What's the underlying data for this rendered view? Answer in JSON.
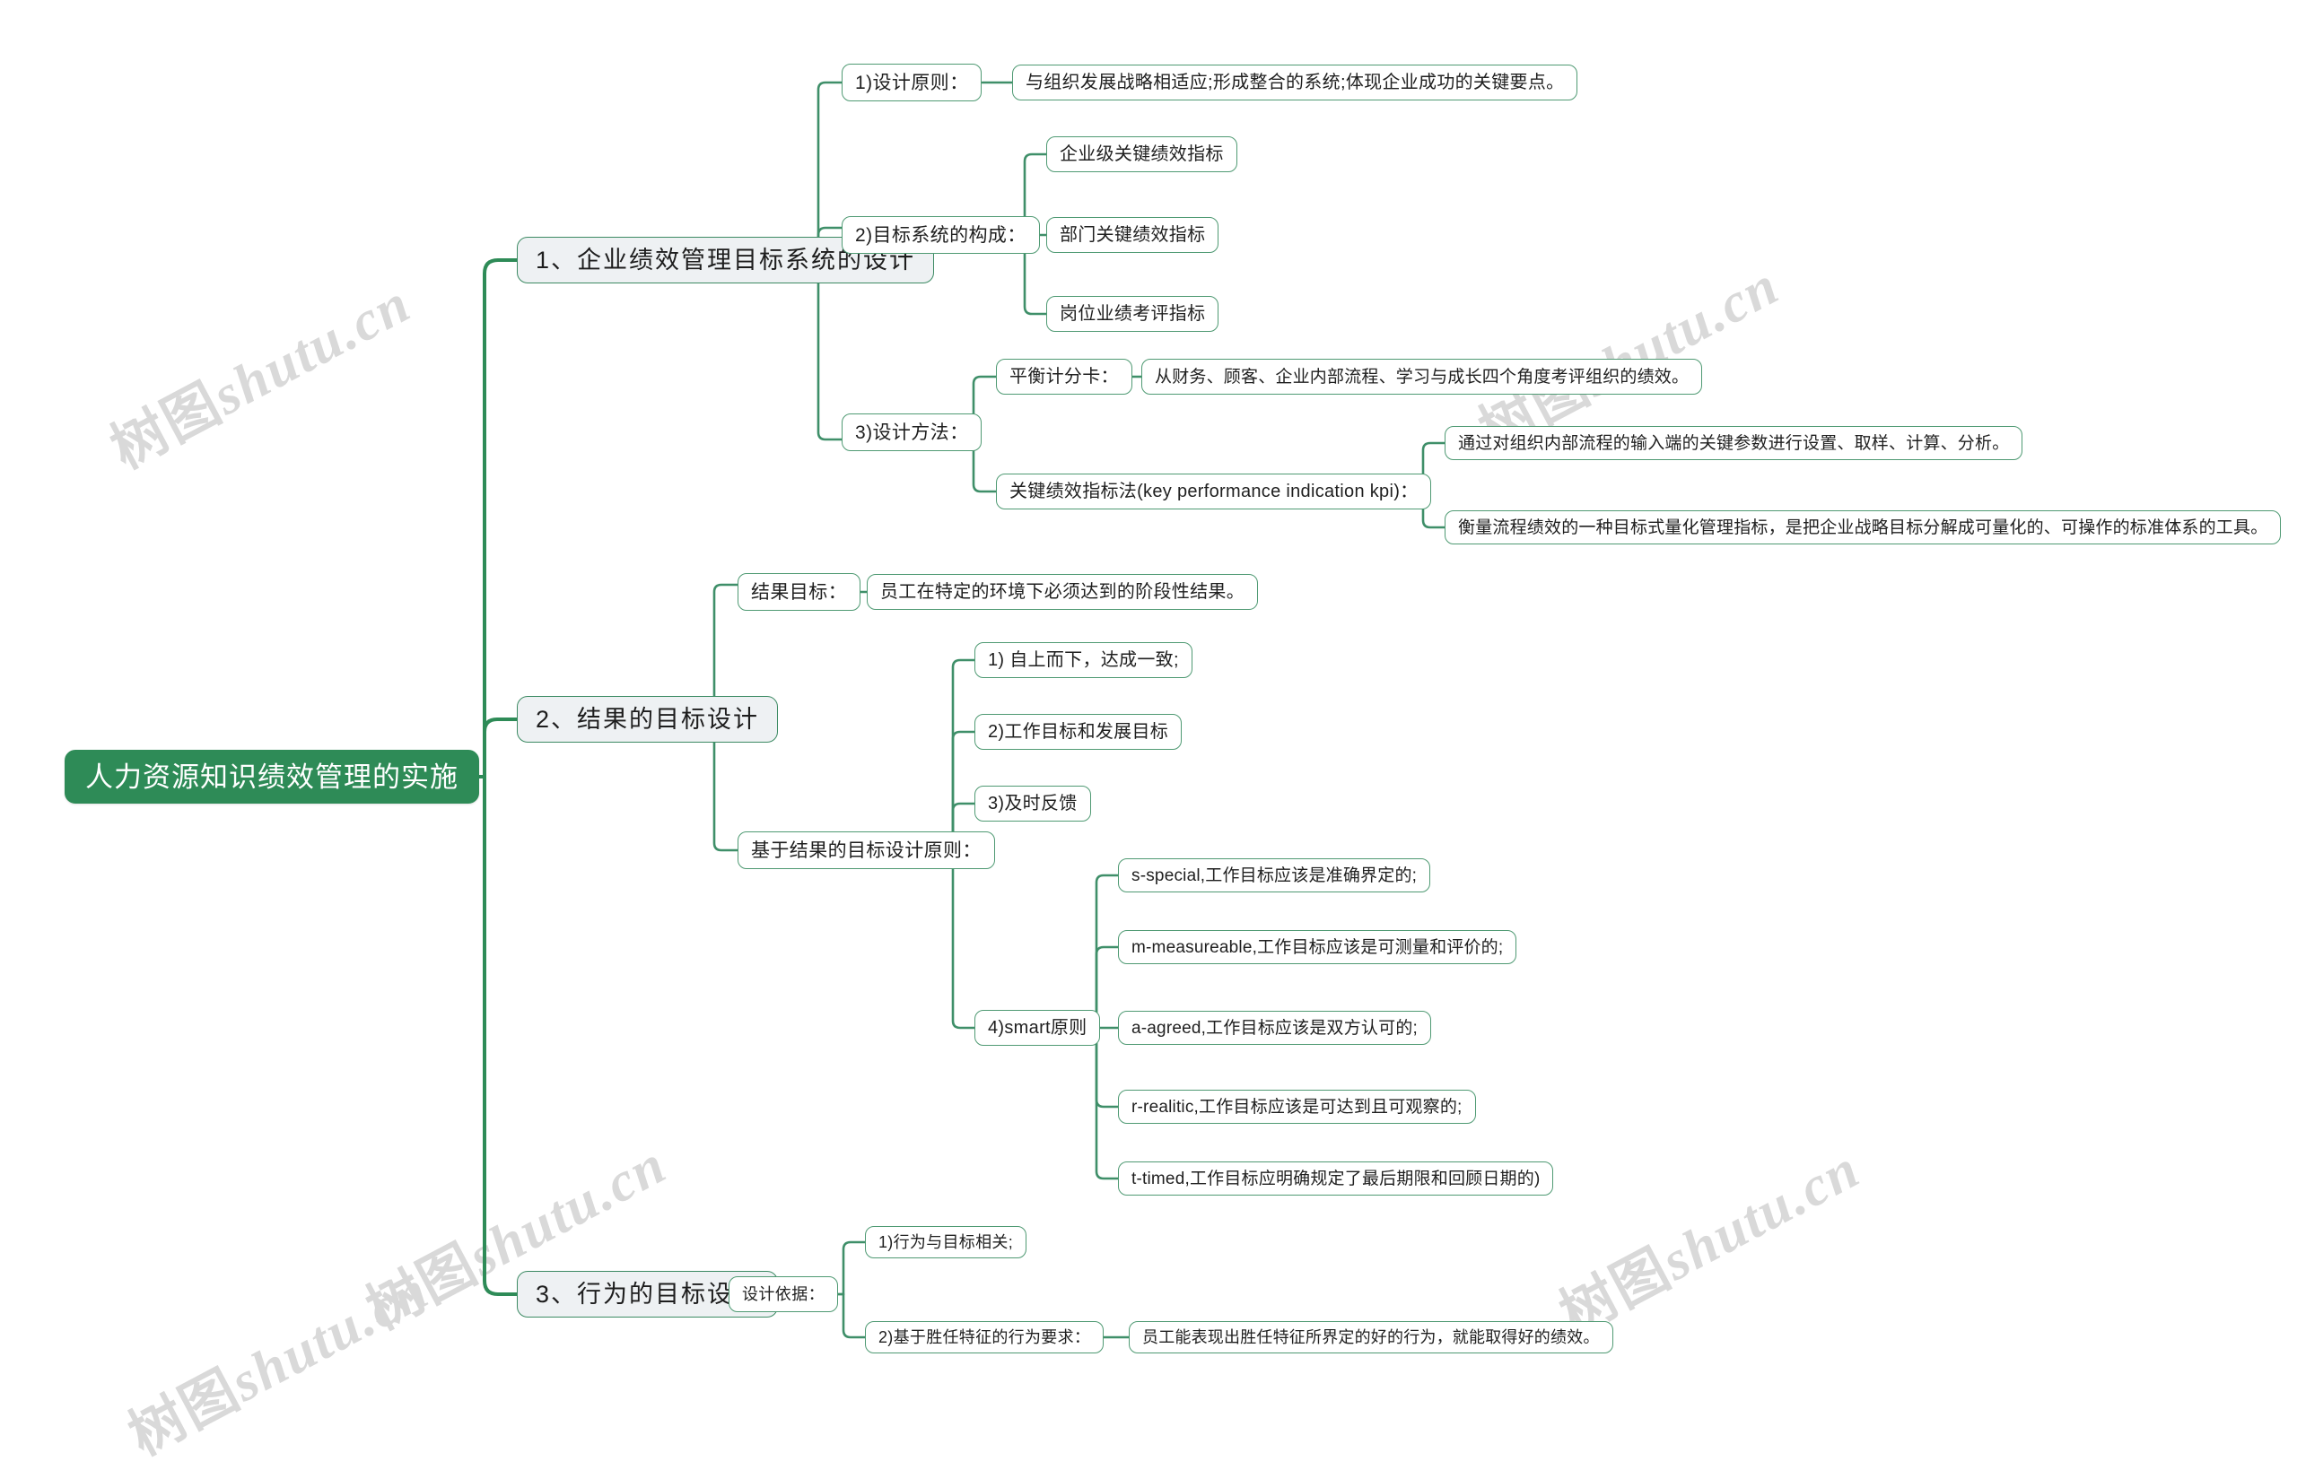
{
  "meta": {
    "watermark_text_cjk": "树图",
    "watermark_text_latin": "shutu.cn",
    "accent_green": "#2e8b57",
    "node_border_green": "#4f9a73",
    "lvl1_fill": "#eef1f3",
    "background": "#ffffff"
  },
  "mindmap": {
    "type": "mindmap",
    "root": "人力资源知识绩效管理的实施",
    "branches": [
      {
        "label": "1、企业绩效管理目标系统的设计",
        "children": [
          {
            "label": "1)设计原则：",
            "children": [
              {
                "label": "与组织发展战略相适应;形成整合的系统;体现企业成功的关键要点。",
                "children": []
              }
            ]
          },
          {
            "label": "2)目标系统的构成：",
            "children": [
              {
                "label": "企业级关键绩效指标",
                "children": []
              },
              {
                "label": "部门关键绩效指标",
                "children": []
              },
              {
                "label": "岗位业绩考评指标",
                "children": []
              }
            ]
          },
          {
            "label": "3)设计方法：",
            "children": [
              {
                "label": "平衡计分卡：",
                "children": [
                  {
                    "label": "从财务、顾客、企业内部流程、学习与成长四个角度考评组织的绩效。",
                    "children": []
                  }
                ]
              },
              {
                "label": "关键绩效指标法(key performance indication kpi)：",
                "children": [
                  {
                    "label": "通过对组织内部流程的输入端的关键参数进行设置、取样、计算、分析。",
                    "children": []
                  },
                  {
                    "label": "衡量流程绩效的一种目标式量化管理指标，是把企业战略目标分解成可量化的、可操作的标准体系的工具。",
                    "children": []
                  }
                ]
              }
            ]
          }
        ]
      },
      {
        "label": "2、结果的目标设计",
        "children": [
          {
            "label": "结果目标：",
            "children": [
              {
                "label": "员工在特定的环境下必须达到的阶段性结果。",
                "children": []
              }
            ]
          },
          {
            "label": "基于结果的目标设计原则：",
            "children": [
              {
                "label": "1) 自上而下，达成一致;",
                "children": []
              },
              {
                "label": "2)工作目标和发展目标",
                "children": []
              },
              {
                "label": "3)及时反馈",
                "children": []
              },
              {
                "label": "4)smart原则",
                "children": [
                  {
                    "label": "s-special,工作目标应该是准确界定的;",
                    "children": []
                  },
                  {
                    "label": "m-measureable,工作目标应该是可测量和评价的;",
                    "children": []
                  },
                  {
                    "label": "a-agreed,工作目标应该是双方认可的;",
                    "children": []
                  },
                  {
                    "label": "r-realitic,工作目标应该是可达到且可观察的;",
                    "children": []
                  },
                  {
                    "label": "t-timed,工作目标应明确规定了最后期限和回顾日期的)",
                    "children": []
                  }
                ]
              }
            ]
          }
        ]
      },
      {
        "label": "3、行为的目标设计",
        "children": [
          {
            "label": "设计依据：",
            "children": [
              {
                "label": "1)行为与目标相关;",
                "children": []
              },
              {
                "label": "2)基于胜任特征的行为要求：",
                "children": [
                  {
                    "label": "员工能表现出胜任特征所界定的好的行为，就能取得好的绩效。",
                    "children": []
                  }
                ]
              }
            ]
          }
        ]
      }
    ]
  },
  "nodes": {
    "root": "人力资源知识绩效管理的实施",
    "b1": "1、企业绩效管理目标系统的设计",
    "b1_1": "1)设计原则：",
    "b1_1_1": "与组织发展战略相适应;形成整合的系统;体现企业成功的关键要点。",
    "b1_2": "2)目标系统的构成：",
    "b1_2_1": "企业级关键绩效指标",
    "b1_2_2": "部门关键绩效指标",
    "b1_2_3": "岗位业绩考评指标",
    "b1_3": "3)设计方法：",
    "b1_3_1": "平衡计分卡：",
    "b1_3_1_1": "从财务、顾客、企业内部流程、学习与成长四个角度考评组织的绩效。",
    "b1_3_2": "关键绩效指标法(key performance indication kpi)：",
    "b1_3_2_1": "通过对组织内部流程的输入端的关键参数进行设置、取样、计算、分析。",
    "b1_3_2_2": "衡量流程绩效的一种目标式量化管理指标，是把企业战略目标分解成可量化的、可操作的标准体系的工具。",
    "b2": "2、结果的目标设计",
    "b2_1": "结果目标：",
    "b2_1_1": "员工在特定的环境下必须达到的阶段性结果。",
    "b2_2": "基于结果的目标设计原则：",
    "b2_2_1": "1) 自上而下，达成一致;",
    "b2_2_2": "2)工作目标和发展目标",
    "b2_2_3": "3)及时反馈",
    "b2_2_4": "4)smart原则",
    "b2_2_4_1": "s-special,工作目标应该是准确界定的;",
    "b2_2_4_2": "m-measureable,工作目标应该是可测量和评价的;",
    "b2_2_4_3": "a-agreed,工作目标应该是双方认可的;",
    "b2_2_4_4": "r-realitic,工作目标应该是可达到且可观察的;",
    "b2_2_4_5": "t-timed,工作目标应明确规定了最后期限和回顾日期的)",
    "b3": "3、行为的目标设计",
    "b3_1": "设计依据：",
    "b3_1_1": "1)行为与目标相关;",
    "b3_1_2": "2)基于胜任特征的行为要求：",
    "b3_1_2_1": "员工能表现出胜任特征所界定的好的行为，就能取得好的绩效。"
  }
}
